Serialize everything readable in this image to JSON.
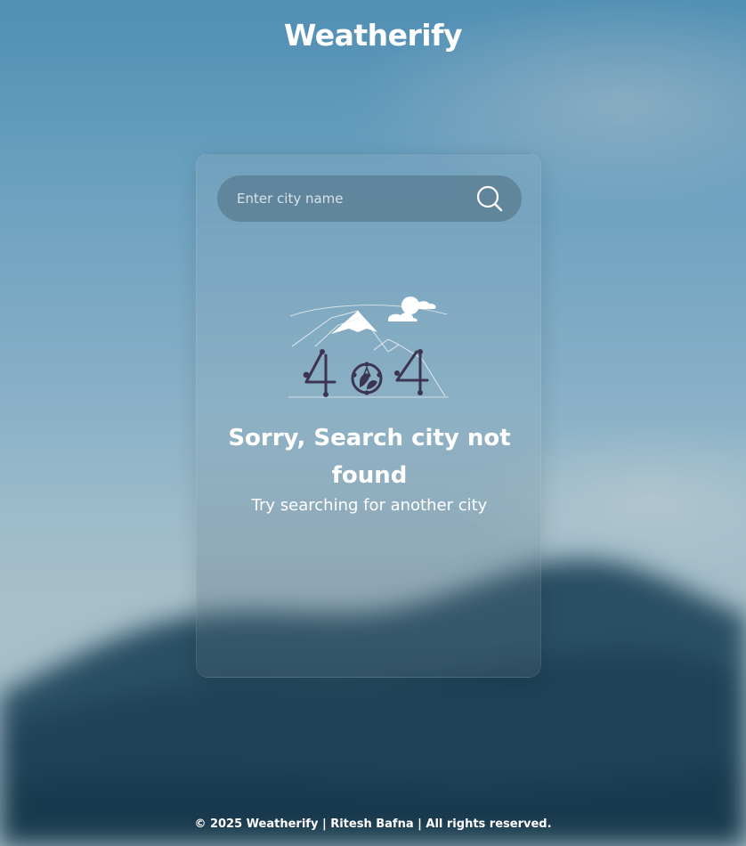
{
  "app": {
    "title": "Weatherify"
  },
  "search": {
    "placeholder": "Enter city name",
    "value": ""
  },
  "icons": {
    "search": "search-icon",
    "illustration": "404-mountain-illustration"
  },
  "error": {
    "title": "Sorry, Search city not found",
    "subtitle": "Try searching for another city",
    "code_art": "404"
  },
  "footer": {
    "text": "© 2025 Weatherify | Ritesh Bafna | All rights reserved."
  },
  "colors": {
    "text": "#ffffff",
    "illustration_ink": "#3b3552",
    "sky_top": "#4e8db3",
    "mountain_dark": "#1f4257"
  }
}
